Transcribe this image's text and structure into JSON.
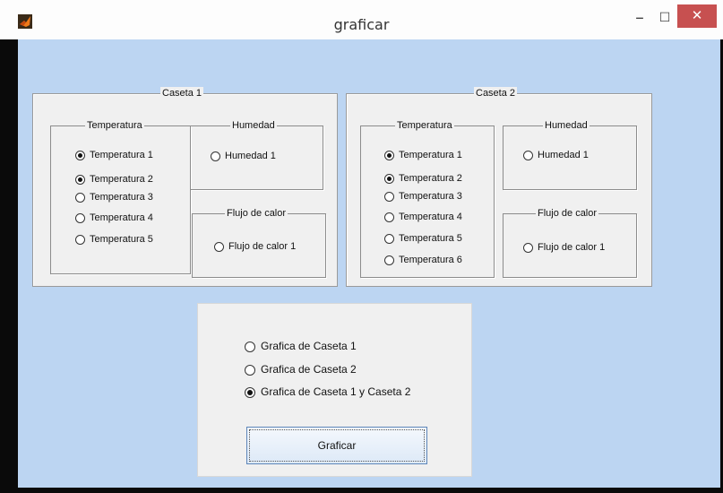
{
  "window": {
    "title": "graficar",
    "minimize": "‒",
    "maximize": "☐",
    "close": "✕"
  },
  "panels": [
    {
      "title": "Caseta 1",
      "temperatura": {
        "title": "Temperatura",
        "options": [
          {
            "label": "Temperatura 1",
            "selected": true
          },
          {
            "label": "Temperatura 2",
            "selected": true
          },
          {
            "label": "Temperatura 3",
            "selected": false
          },
          {
            "label": "Temperatura 4",
            "selected": false
          },
          {
            "label": "Temperatura 5",
            "selected": false
          }
        ]
      },
      "humedad": {
        "title": "Humedad",
        "option": {
          "label": "Humedad 1",
          "selected": false
        }
      },
      "flujo": {
        "title": "Flujo de calor",
        "option": {
          "label": "Flujo de calor 1",
          "selected": false
        }
      }
    },
    {
      "title": "Caseta 2",
      "temperatura": {
        "title": "Temperatura",
        "options": [
          {
            "label": "Temperatura 1",
            "selected": true
          },
          {
            "label": "Temperatura 2",
            "selected": true
          },
          {
            "label": "Temperatura 3",
            "selected": false
          },
          {
            "label": "Temperatura 4",
            "selected": false
          },
          {
            "label": "Temperatura 5",
            "selected": false
          },
          {
            "label": "Temperatura 6",
            "selected": false
          }
        ]
      },
      "humedad": {
        "title": "Humedad",
        "option": {
          "label": "Humedad 1",
          "selected": false
        }
      },
      "flujo": {
        "title": "Flujo de calor",
        "option": {
          "label": "Flujo de calor  1",
          "selected": false
        }
      }
    }
  ],
  "graph_options": [
    {
      "label": "Grafica de Caseta 1",
      "selected": false
    },
    {
      "label": "Grafica de Caseta 2",
      "selected": false
    },
    {
      "label": "Grafica  de Caseta 1 y Caseta 2",
      "selected": true
    }
  ],
  "graficar_button": "Graficar"
}
